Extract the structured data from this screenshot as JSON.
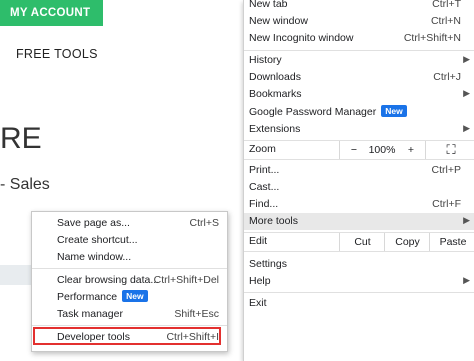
{
  "page": {
    "account_button": "MY ACCOUNT",
    "free_tools": "FREE TOOLS",
    "big_text": "RE",
    "sales_text": "- Sales"
  },
  "menu": {
    "new_tab": {
      "label": "New tab",
      "shortcut": "Ctrl+T"
    },
    "new_window": {
      "label": "New window",
      "shortcut": "Ctrl+N"
    },
    "new_incognito": {
      "label": "New Incognito window",
      "shortcut": "Ctrl+Shift+N"
    },
    "history": {
      "label": "History"
    },
    "downloads": {
      "label": "Downloads",
      "shortcut": "Ctrl+J"
    },
    "bookmarks": {
      "label": "Bookmarks"
    },
    "password_manager": {
      "label": "Google Password Manager",
      "badge": "New"
    },
    "extensions": {
      "label": "Extensions"
    },
    "zoom": {
      "label": "Zoom",
      "minus": "−",
      "value": "100%",
      "plus": "+",
      "fullscreen": "⛶"
    },
    "print": {
      "label": "Print...",
      "shortcut": "Ctrl+P"
    },
    "cast": {
      "label": "Cast..."
    },
    "find": {
      "label": "Find...",
      "shortcut": "Ctrl+F"
    },
    "more_tools": {
      "label": "More tools"
    },
    "edit": {
      "label": "Edit",
      "cut": "Cut",
      "copy": "Copy",
      "paste": "Paste"
    },
    "settings": {
      "label": "Settings"
    },
    "help": {
      "label": "Help"
    },
    "exit": {
      "label": "Exit"
    }
  },
  "submenu": {
    "save_page": {
      "label": "Save page as...",
      "shortcut": "Ctrl+S"
    },
    "create_shortcut": {
      "label": "Create shortcut..."
    },
    "name_window": {
      "label": "Name window..."
    },
    "clear_data": {
      "label": "Clear browsing data...",
      "shortcut": "Ctrl+Shift+Del"
    },
    "performance": {
      "label": "Performance",
      "badge": "New"
    },
    "task_manager": {
      "label": "Task manager",
      "shortcut": "Shift+Esc"
    },
    "developer_tools": {
      "label": "Developer tools",
      "shortcut": "Ctrl+Shift+I"
    }
  },
  "colors": {
    "accent_green": "#2ebd6b",
    "badge_blue": "#1a73e8",
    "highlight_red": "#e3302f"
  }
}
